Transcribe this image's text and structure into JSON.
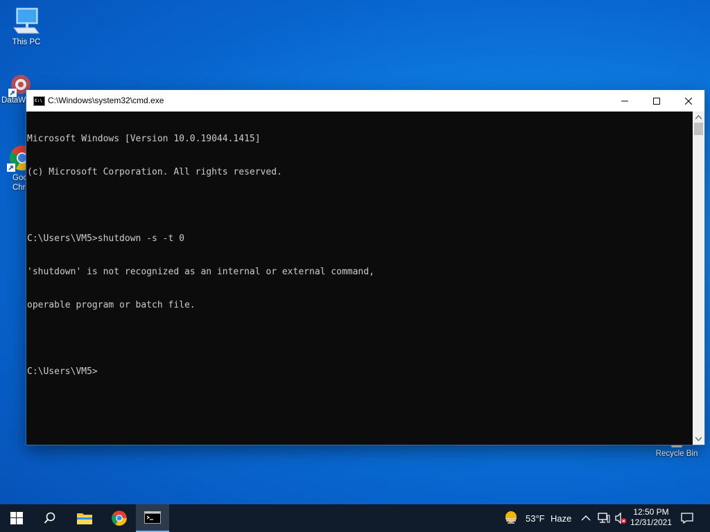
{
  "desktop": {
    "icons": [
      {
        "label": "This PC"
      },
      {
        "label": "DataW"
      },
      {
        "label": "Goo Chro"
      },
      {
        "label": "Recycle Bin"
      }
    ]
  },
  "window": {
    "title": "C:\\Windows\\system32\\cmd.exe",
    "icon_text": "C:\\"
  },
  "console": {
    "lines": [
      "Microsoft Windows [Version 10.0.19044.1415]",
      "(c) Microsoft Corporation. All rights reserved.",
      "",
      "C:\\Users\\VM5>shutdown -s -t 0",
      "'shutdown' is not recognized as an internal or external command,",
      "operable program or batch file.",
      "",
      "C:\\Users\\VM5>"
    ]
  },
  "taskbar": {
    "weather_temp": "53°F",
    "weather_cond": "Haze",
    "time": "12:50 PM",
    "date": "12/31/2021"
  },
  "colors": {
    "console_bg": "#0c0c0c",
    "console_fg": "#cccccc",
    "taskbar_bg": "#101c2c"
  }
}
